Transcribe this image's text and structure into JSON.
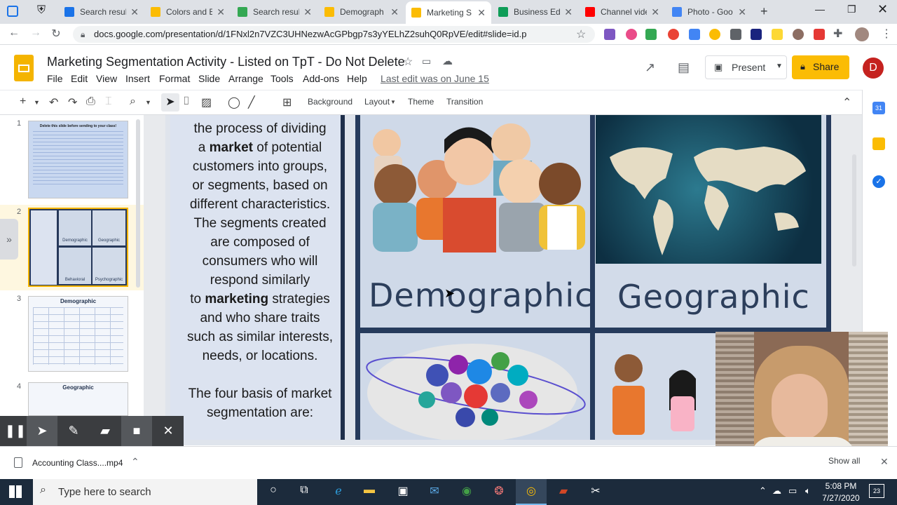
{
  "browser": {
    "tabs": [
      {
        "label": "Search result",
        "color": "#1a73e8",
        "active": false
      },
      {
        "label": "Colors and B",
        "color": "#fbbc04",
        "active": false
      },
      {
        "label": "Search result",
        "color": "#34a853",
        "active": false
      },
      {
        "label": "Demograph",
        "color": "#fbbc04",
        "active": false
      },
      {
        "label": "Marketing S",
        "color": "#fbbc04",
        "active": true
      },
      {
        "label": "Business Ed",
        "color": "#0f9d58",
        "active": false
      },
      {
        "label": "Channel vide",
        "color": "#ff0000",
        "active": false
      },
      {
        "label": "Photo - Goo",
        "color": "#4285f4",
        "active": false
      }
    ],
    "url": "docs.google.com/presentation/d/1FNxl2n7VZC3UHNezwAcGPbgp7s3yYELhZ2suhQ0RpVE/edit#slide=id.p",
    "profile_initial": "D"
  },
  "docs": {
    "title": "Marketing Segmentation Activity  - Listed on TpT - Do Not Delete",
    "menu": [
      "File",
      "Edit",
      "View",
      "Insert",
      "Format",
      "Slide",
      "Arrange",
      "Tools",
      "Add-ons",
      "Help"
    ],
    "last_edit": "Last edit was on June 15",
    "present_label": "Present",
    "share_label": "Share",
    "user_initial": "D",
    "toolbar_text": [
      "Background",
      "Layout",
      "Theme",
      "Transition"
    ]
  },
  "filmstrip": {
    "slides": [
      {
        "num": "1",
        "caption": "Delete this slide before sending to your class!"
      },
      {
        "num": "2",
        "caption": ""
      },
      {
        "num": "3",
        "caption": "Demographic"
      },
      {
        "num": "4",
        "caption": "Geographic"
      }
    ],
    "thumb2_labels": [
      "Demographic",
      "Geographic",
      "Behavioral",
      "Psychographic"
    ]
  },
  "slide": {
    "body_lines": [
      "the process of dividing",
      "a __market__ of potential",
      "customers into groups,",
      "or segments,  based on",
      "different characteristics.",
      "The segments created",
      "are composed of",
      "consumers who will",
      "respond similarly",
      "to __marketing__ strategies",
      "and who share traits",
      "such as similar interests,",
      "needs, or locations.",
      "",
      "The four basis of market",
      "segmentation are:"
    ],
    "labels": {
      "demographic": "Demographic",
      "geographic": "Geographic"
    }
  },
  "downloads": {
    "file": "Accounting Class....mp4",
    "show_all": "Show all"
  },
  "taskbar": {
    "search_placeholder": "Type here to search",
    "time": "5:08 PM",
    "date": "7/27/2020",
    "notif_count": "23"
  }
}
